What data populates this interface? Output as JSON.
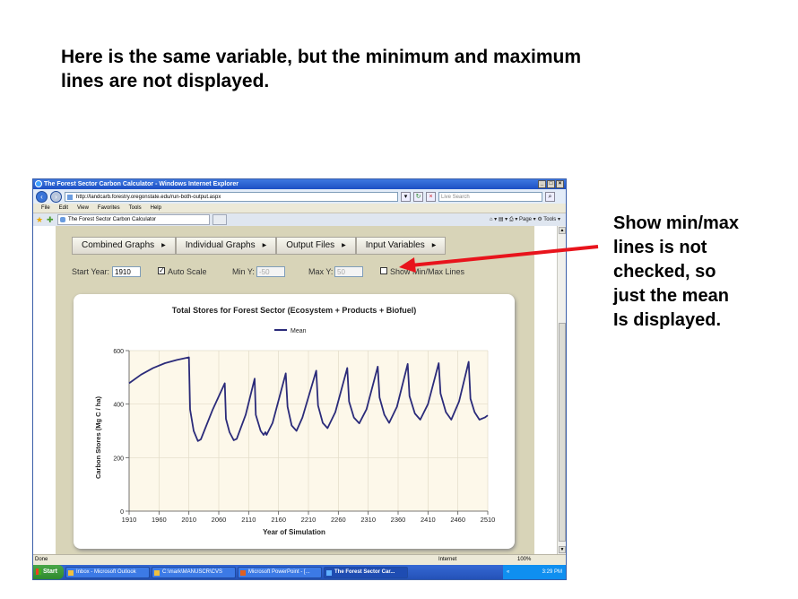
{
  "slide": {
    "title_line1": "Here is the same variable, but the minimum and maximum",
    "title_line2": "lines are not displayed.",
    "callout_lines": [
      "Show min/max",
      "lines is not",
      "checked, so",
      "just the mean",
      "Is displayed."
    ],
    "arrow_color": "#e8141c"
  },
  "browser": {
    "window_title": "The Forest Sector Carbon Calculator - Windows Internet Explorer",
    "url": "http://landcarb.forestry.oregonstate.edu/run-both-output.aspx",
    "search_placeholder": "Live Search",
    "menu": [
      "File",
      "Edit",
      "View",
      "Favorites",
      "Tools",
      "Help"
    ],
    "tab_label": "The Forest Sector Carbon Calculator",
    "tools_text": "⌂ ▾  ▤ ▾  ⎙ ▾  Page ▾  ⚙ Tools ▾",
    "status_left": "Done",
    "status_zone": "Internet",
    "status_zoom": "100%"
  },
  "app": {
    "menu_buttons": [
      "Combined Graphs",
      "Individual Graphs",
      "Output Files",
      "Input Variables"
    ],
    "start_year_label": "Start Year:",
    "start_year_value": "1910",
    "auto_scale_label": "Auto Scale",
    "auto_scale_checked": true,
    "min_y_label": "Min Y:",
    "min_y_value": "-50",
    "max_y_label": "Max Y:",
    "max_y_value": "50",
    "minmax_label": "Show Min/Max Lines",
    "minmax_checked": false
  },
  "taskbar": {
    "start": "Start",
    "tasks": [
      "Inbox - Microsoft Outlook",
      "C:\\mark\\MANUSCR\\CVS",
      "Microsoft PowerPoint - [...",
      "The Forest Sector Car..."
    ],
    "time": "3:29 PM"
  },
  "chart_data": {
    "type": "line",
    "title": "Total Stores for Forest Sector (Ecosystem + Products + Biofuel)",
    "xlabel": "Year of Simulation",
    "ylabel": "Carbon Stores (Mg C / ha)",
    "xlim": [
      1910,
      2510
    ],
    "ylim": [
      0,
      600
    ],
    "xticks": [
      1910,
      1960,
      2010,
      2060,
      2110,
      2160,
      2210,
      2260,
      2310,
      2360,
      2410,
      2460,
      2510
    ],
    "yticks": [
      0,
      200,
      400,
      600
    ],
    "grid": true,
    "legend_position": "top-center",
    "series": [
      {
        "name": "Mean",
        "color": "#2b2b7a",
        "points": [
          [
            1910,
            478
          ],
          [
            1930,
            510
          ],
          [
            1950,
            535
          ],
          [
            1970,
            553
          ],
          [
            1990,
            565
          ],
          [
            2010,
            575
          ],
          [
            2012,
            380
          ],
          [
            2018,
            300
          ],
          [
            2025,
            262
          ],
          [
            2030,
            268
          ],
          [
            2050,
            380
          ],
          [
            2070,
            478
          ],
          [
            2072,
            345
          ],
          [
            2078,
            295
          ],
          [
            2085,
            265
          ],
          [
            2090,
            270
          ],
          [
            2105,
            360
          ],
          [
            2120,
            495
          ],
          [
            2122,
            360
          ],
          [
            2130,
            300
          ],
          [
            2135,
            285
          ],
          [
            2138,
            295
          ],
          [
            2140,
            285
          ],
          [
            2150,
            330
          ],
          [
            2172,
            515
          ],
          [
            2175,
            390
          ],
          [
            2182,
            320
          ],
          [
            2190,
            300
          ],
          [
            2200,
            350
          ],
          [
            2223,
            525
          ],
          [
            2226,
            395
          ],
          [
            2234,
            330
          ],
          [
            2242,
            310
          ],
          [
            2255,
            370
          ],
          [
            2275,
            535
          ],
          [
            2278,
            410
          ],
          [
            2286,
            350
          ],
          [
            2295,
            328
          ],
          [
            2307,
            380
          ],
          [
            2326,
            540
          ],
          [
            2329,
            425
          ],
          [
            2337,
            360
          ],
          [
            2345,
            330
          ],
          [
            2358,
            390
          ],
          [
            2376,
            550
          ],
          [
            2379,
            430
          ],
          [
            2388,
            365
          ],
          [
            2397,
            342
          ],
          [
            2410,
            400
          ],
          [
            2428,
            553
          ],
          [
            2431,
            440
          ],
          [
            2440,
            370
          ],
          [
            2449,
            342
          ],
          [
            2462,
            410
          ],
          [
            2478,
            558
          ],
          [
            2481,
            420
          ],
          [
            2488,
            370
          ],
          [
            2496,
            342
          ],
          [
            2505,
            350
          ],
          [
            2510,
            358
          ]
        ]
      }
    ]
  }
}
